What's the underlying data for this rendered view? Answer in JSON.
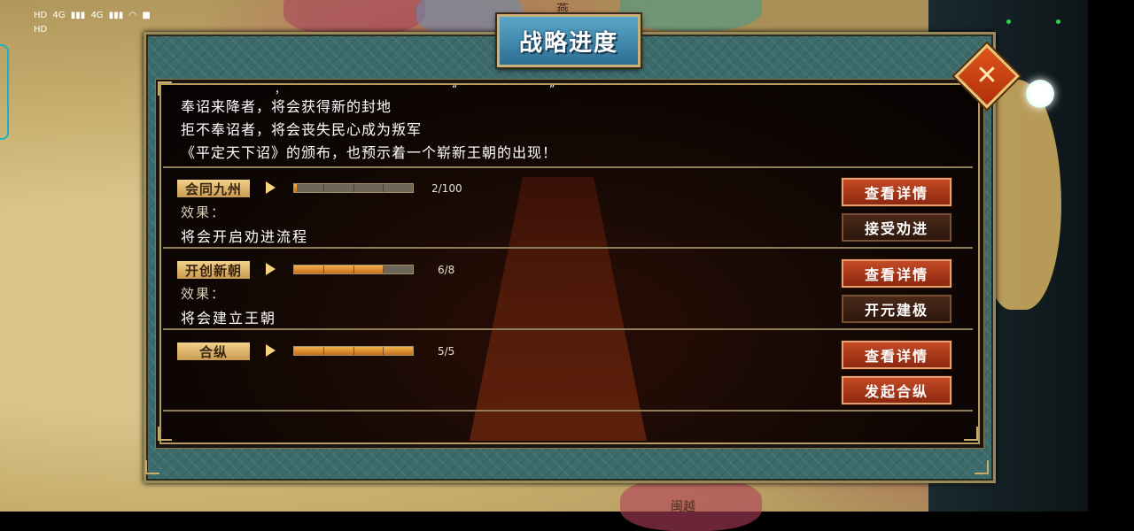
{
  "status_bar": {
    "hd1": "HD",
    "net1": "4G",
    "hd2": "HD",
    "net2": "4G"
  },
  "map": {
    "label_top": "燕",
    "label_bottom": "闽越"
  },
  "dialog": {
    "title": "战略进度",
    "close_icon": "close-icon",
    "intro_lines": [
      "奉诏来降者，将会获得新的封地",
      "拒不奉诏者，将会丧失民心成为叛军",
      "《平定天下诏》的颁布，也预示着一个崭新王朝的出现！"
    ],
    "quote_mark_1": "，",
    "quote_mark_2": "“",
    "quote_mark_3": "”",
    "goals": [
      {
        "name": "会同九州",
        "progress_text": "2/100",
        "progress": 0.02,
        "effect_label": "效果：",
        "effect_text": "将会开启劝进流程",
        "detail_button": "查看详情",
        "action_button": "接受劝进"
      },
      {
        "name": "开创新朝",
        "progress_text": "6/8",
        "progress": 0.75,
        "effect_label": "效果：",
        "effect_text": "将会建立王朝",
        "detail_button": "查看详情",
        "action_button": "开元建极"
      },
      {
        "name": "合纵",
        "progress_text": "5/5",
        "progress": 1.0,
        "effect_label": "",
        "effect_text": "",
        "detail_button": "查看详情",
        "action_button": "发起合纵"
      }
    ]
  },
  "colors": {
    "panel_frame": "#3d6b6b",
    "tag_gold": "#f3d28a",
    "progress_fill": "#e08a2a",
    "button_red": "#b03a1a",
    "title_blue": "#3e88b0"
  }
}
